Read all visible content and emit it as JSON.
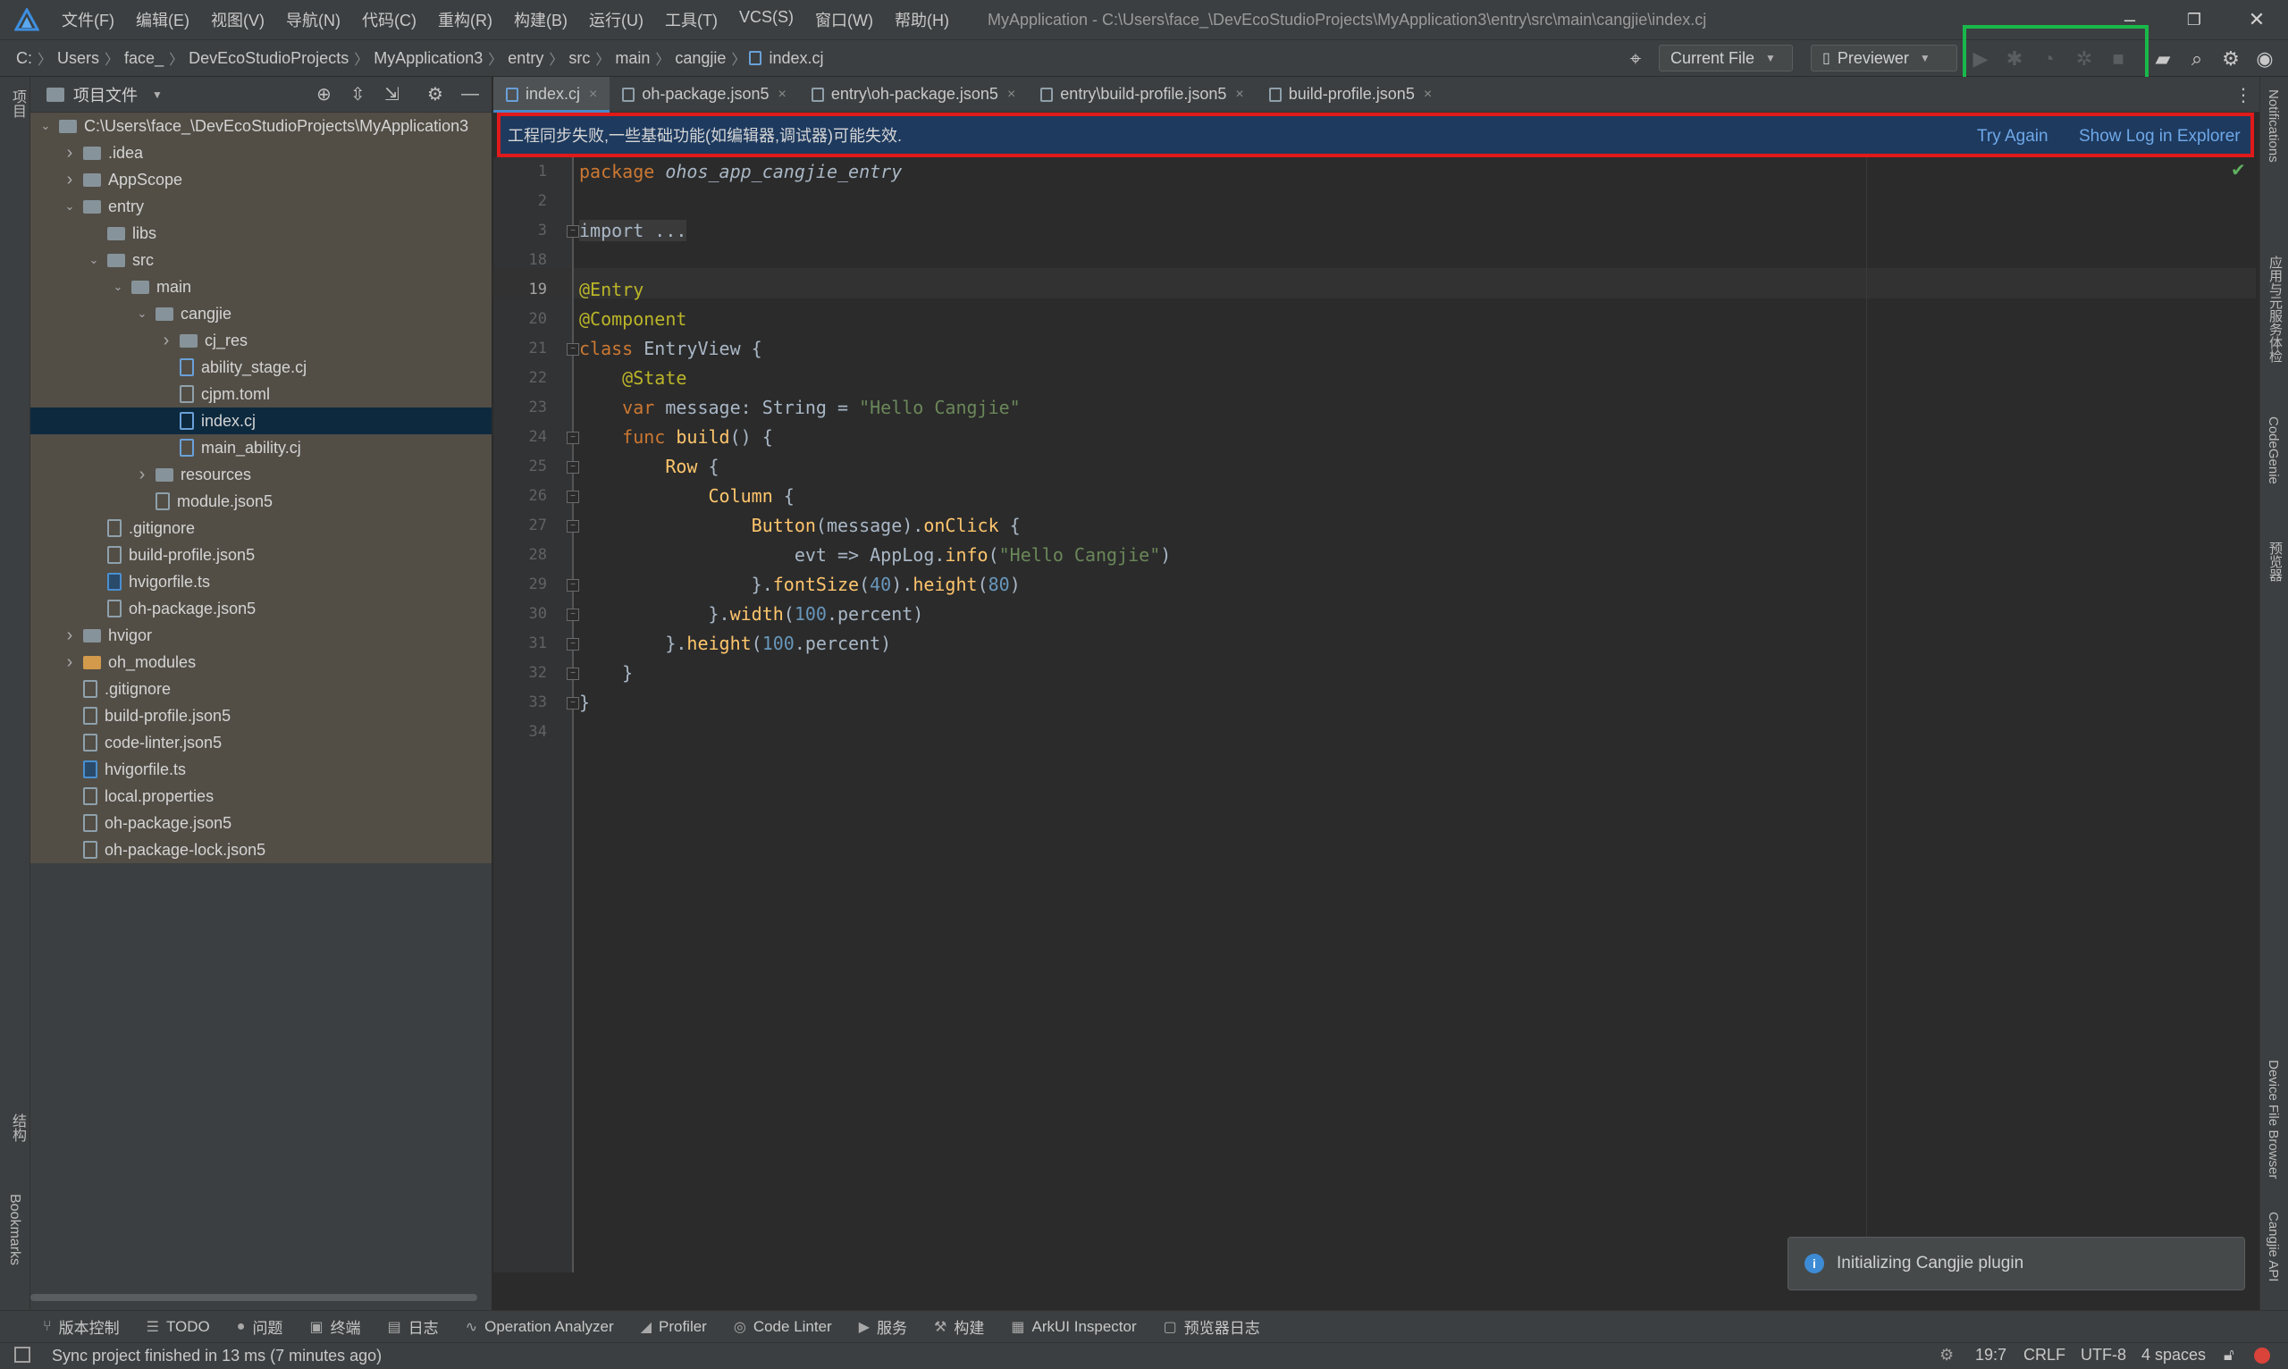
{
  "menu": [
    "文件(F)",
    "编辑(E)",
    "视图(V)",
    "导航(N)",
    "代码(C)",
    "重构(R)",
    "构建(B)",
    "运行(U)",
    "工具(T)",
    "VCS(S)",
    "窗口(W)",
    "帮助(H)"
  ],
  "window_title": "MyApplication - C:\\Users\\face_\\DevEcoStudioProjects\\MyApplication3\\entry\\src\\main\\cangjie\\index.cj",
  "window_controls": {
    "minimize": "–",
    "maximize": "❐",
    "close": "✕"
  },
  "breadcrumb": [
    "C:",
    "Users",
    "face_",
    "DevEcoStudioProjects",
    "MyApplication3",
    "entry",
    "src",
    "main",
    "cangjie",
    "index.cj"
  ],
  "toolbar": {
    "run_config": "Current File",
    "device": "Previewer"
  },
  "left_stripe": {
    "project": "项目",
    "structure": "结构",
    "bookmarks": "Bookmarks"
  },
  "project_panel": {
    "title": "项目文件",
    "tree": [
      {
        "label": "C:\\Users\\face_\\DevEcoStudioProjects\\MyApplication3",
        "type": "folder",
        "depth": 0,
        "expanded": true
      },
      {
        "label": ".idea",
        "type": "folder",
        "depth": 1,
        "expanded": false
      },
      {
        "label": "AppScope",
        "type": "folder",
        "depth": 1,
        "expanded": false
      },
      {
        "label": "entry",
        "type": "folder",
        "depth": 1,
        "expanded": true
      },
      {
        "label": "libs",
        "type": "folder",
        "depth": 2,
        "leaf": true
      },
      {
        "label": "src",
        "type": "folder",
        "depth": 2,
        "expanded": true
      },
      {
        "label": "main",
        "type": "folder",
        "depth": 3,
        "expanded": true
      },
      {
        "label": "cangjie",
        "type": "folder",
        "depth": 4,
        "expanded": true
      },
      {
        "label": "cj_res",
        "type": "folder",
        "depth": 5,
        "expanded": false
      },
      {
        "label": "ability_stage.cj",
        "type": "cj",
        "depth": 5
      },
      {
        "label": "cjpm.toml",
        "type": "file",
        "depth": 5
      },
      {
        "label": "index.cj",
        "type": "cj",
        "depth": 5,
        "selected": true
      },
      {
        "label": "main_ability.cj",
        "type": "cj",
        "depth": 5
      },
      {
        "label": "resources",
        "type": "folder",
        "depth": 4,
        "expanded": false
      },
      {
        "label": "module.json5",
        "type": "file",
        "depth": 4
      },
      {
        "label": ".gitignore",
        "type": "file",
        "depth": 2
      },
      {
        "label": "build-profile.json5",
        "type": "file",
        "depth": 2
      },
      {
        "label": "hvigorfile.ts",
        "type": "ts",
        "depth": 2
      },
      {
        "label": "oh-package.json5",
        "type": "file",
        "depth": 2
      },
      {
        "label": "hvigor",
        "type": "folder",
        "depth": 1,
        "expanded": false
      },
      {
        "label": "oh_modules",
        "type": "folder-orange",
        "depth": 1,
        "expanded": false
      },
      {
        "label": ".gitignore",
        "type": "file",
        "depth": 1
      },
      {
        "label": "build-profile.json5",
        "type": "file",
        "depth": 1
      },
      {
        "label": "code-linter.json5",
        "type": "file",
        "depth": 1
      },
      {
        "label": "hvigorfile.ts",
        "type": "ts",
        "depth": 1
      },
      {
        "label": "local.properties",
        "type": "file",
        "depth": 1
      },
      {
        "label": "oh-package.json5",
        "type": "file",
        "depth": 1
      },
      {
        "label": "oh-package-lock.json5",
        "type": "file",
        "depth": 1
      }
    ]
  },
  "tabs": [
    {
      "label": "index.cj",
      "active": true
    },
    {
      "label": "oh-package.json5",
      "active": false
    },
    {
      "label": "entry\\oh-package.json5",
      "active": false
    },
    {
      "label": "entry\\build-profile.json5",
      "active": false
    },
    {
      "label": "build-profile.json5",
      "active": false
    }
  ],
  "banner": {
    "message": "工程同步失败,一些基础功能(如编辑器,调试器)可能失效.",
    "try_again": "Try Again",
    "show_log": "Show Log in Explorer"
  },
  "code_lines": [
    {
      "n": "1",
      "html": "<span class=\"kw\">package</span> <span class=\"it\" style=\"color:#a9b7c6\">ohos_app_cangjie_entry</span>"
    },
    {
      "n": "2",
      "html": ""
    },
    {
      "n": "3",
      "html": "<span style=\"background:#3a3a3a;color:#a9b7c6\">import ...</span>"
    },
    {
      "n": "18",
      "html": ""
    },
    {
      "n": "19",
      "html": "<span class=\"ann\">@Entry</span>"
    },
    {
      "n": "20",
      "html": "<span class=\"ann\">@Component</span>"
    },
    {
      "n": "21",
      "html": "<span class=\"kw\">class</span> EntryView {"
    },
    {
      "n": "22",
      "html": "    <span class=\"ann\">@State</span>"
    },
    {
      "n": "23",
      "html": "    <span class=\"kw\">var</span> message: String = <span class=\"str\">\"Hello Cangjie\"</span>"
    },
    {
      "n": "24",
      "html": "    <span class=\"kw\">func</span> <span class=\"fn\">build</span>() {"
    },
    {
      "n": "25",
      "html": "        <span class=\"fn\">Row</span> {"
    },
    {
      "n": "26",
      "html": "            <span class=\"fn\">Column</span> {"
    },
    {
      "n": "27",
      "html": "                <span class=\"fn\">Button</span>(message).<span class=\"fn\">onClick</span> {"
    },
    {
      "n": "28",
      "html": "                    evt => AppLog.<span class=\"fn\">info</span>(<span class=\"str\">\"Hello Cangjie\"</span>)"
    },
    {
      "n": "29",
      "html": "                }.<span class=\"fn\">fontSize</span>(<span class=\"num\">40</span>).<span class=\"fn\">height</span>(<span class=\"num\">80</span>)"
    },
    {
      "n": "30",
      "html": "            }.<span class=\"fn\">width</span>(<span class=\"num\">100</span>.percent)"
    },
    {
      "n": "31",
      "html": "        }.<span class=\"fn\">height</span>(<span class=\"num\">100</span>.percent)"
    },
    {
      "n": "32",
      "html": "    }"
    },
    {
      "n": "33",
      "html": "}"
    },
    {
      "n": "34",
      "html": ""
    }
  ],
  "right_stripe": [
    "Notifications",
    "应用与元服务体检",
    "CodeGenie",
    "预览器",
    "Device File Browser",
    "Cangjie API"
  ],
  "toast": {
    "message": "Initializing Cangjie plugin"
  },
  "bottom_tools": [
    {
      "icon": "⑂",
      "label": "版本控制"
    },
    {
      "icon": "☰",
      "label": "TODO"
    },
    {
      "icon": "●",
      "label": "问题"
    },
    {
      "icon": "▣",
      "label": "终端"
    },
    {
      "icon": "▤",
      "label": "日志"
    },
    {
      "icon": "∿",
      "label": "Operation Analyzer"
    },
    {
      "icon": "◢",
      "label": "Profiler"
    },
    {
      "icon": "◎",
      "label": "Code Linter"
    },
    {
      "icon": "▶",
      "label": "服务"
    },
    {
      "icon": "⚒",
      "label": "构建"
    },
    {
      "icon": "▦",
      "label": "ArkUI Inspector"
    },
    {
      "icon": "▢",
      "label": "预览器日志"
    }
  ],
  "status": {
    "message": "Sync project finished in 13 ms (7 minutes ago)",
    "position": "19:7",
    "line_sep": "CRLF",
    "encoding": "UTF-8",
    "indent": "4 spaces"
  }
}
